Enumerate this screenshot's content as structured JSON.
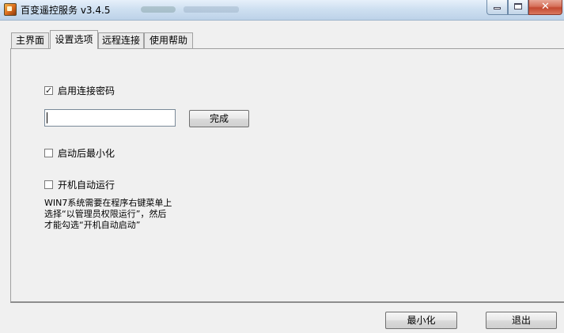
{
  "window": {
    "title": "百变遥控服务 v3.4.5",
    "controls": {
      "minimize": "minimize",
      "maximize": "maximize",
      "close": "✕"
    }
  },
  "tabs": [
    {
      "label": "主界面",
      "active": false
    },
    {
      "label": "设置选项",
      "active": true
    },
    {
      "label": "远程连接",
      "active": false
    },
    {
      "label": "使用帮助",
      "active": false
    }
  ],
  "settings": {
    "password_option": {
      "label": "启用连接密码",
      "checked": true
    },
    "password_input": {
      "value": "",
      "placeholder": ""
    },
    "done_button": "完成",
    "minimize_on_start": {
      "label": "启动后最小化",
      "checked": false
    },
    "autostart": {
      "label": "开机自动运行",
      "checked": false
    },
    "note_lines": [
      "WIN7系统需要在程序右键菜单上",
      "选择“以管理员权限运行”，然后",
      "才能勾选“开机自动启动”"
    ]
  },
  "footer": {
    "minimize_button": "最小化",
    "exit_button": "退出"
  },
  "icons": {
    "app": "app-icon",
    "check": "✓"
  }
}
